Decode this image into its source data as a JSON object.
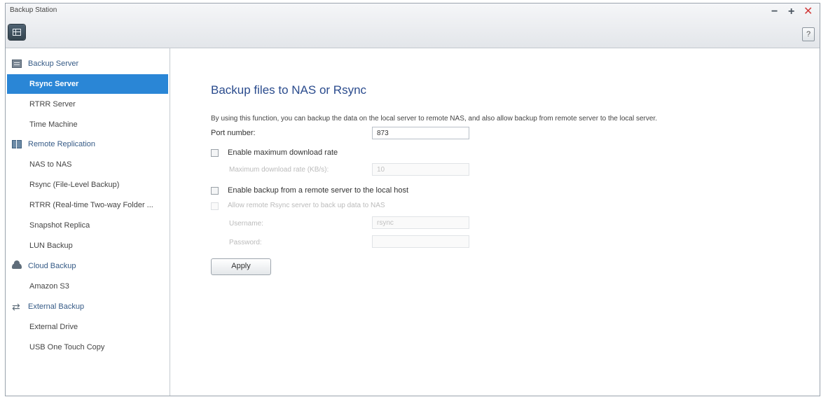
{
  "window": {
    "title": "Backup Station",
    "controls": {
      "minimize": "−",
      "maximize": "+",
      "close": "✕"
    },
    "help": "?"
  },
  "sidebar": {
    "groups": [
      {
        "label": "Backup Server",
        "icon": "server-icon",
        "items": [
          {
            "label": "Rsync Server",
            "active": true
          },
          {
            "label": "RTRR Server"
          },
          {
            "label": "Time Machine"
          }
        ]
      },
      {
        "label": "Remote Replication",
        "icon": "replication-icon",
        "items": [
          {
            "label": "NAS to NAS"
          },
          {
            "label": "Rsync (File-Level Backup)"
          },
          {
            "label": "RTRR (Real-time Two-way Folder ..."
          },
          {
            "label": "Snapshot Replica"
          },
          {
            "label": "LUN Backup"
          }
        ]
      },
      {
        "label": "Cloud Backup",
        "icon": "cloud-icon",
        "items": [
          {
            "label": "Amazon S3"
          }
        ]
      },
      {
        "label": "External Backup",
        "icon": "sync-arrows-icon",
        "items": [
          {
            "label": "External Drive"
          },
          {
            "label": "USB One Touch Copy"
          }
        ]
      }
    ]
  },
  "main": {
    "heading": "Backup files to NAS or Rsync",
    "description": "By using this function, you can backup the data on the local server to remote NAS, and also allow backup from remote server to the local server.",
    "port_label": "Port number:",
    "port_value": "873",
    "max_download_label": "Enable maximum download rate",
    "max_download_rate_label": "Maximum download rate (KB/s):",
    "max_download_rate_value": "10",
    "remote_backup_label": "Enable backup from a remote server to the local host",
    "allow_rsync_label": "Allow remote Rsync server to back up data to NAS",
    "username_label": "Username:",
    "username_value": "rsync",
    "password_label": "Password:",
    "password_value": "",
    "apply_button": "Apply"
  }
}
